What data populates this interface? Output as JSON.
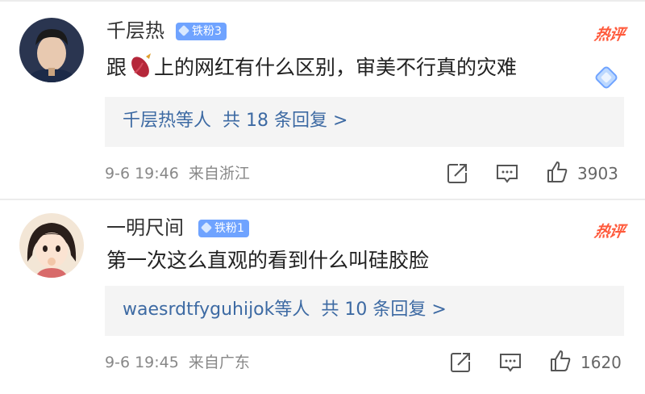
{
  "comments": [
    {
      "username": "千层热",
      "badge": "铁粉3",
      "hot_label": "热评",
      "text_before": "跟",
      "text_after": "上的网红有什么区别，审美不行真的灾难",
      "inline_icon": "sweet-potato-icon",
      "reply": {
        "names": "千层热",
        "deng": "等人",
        "total": "共 18 条回复 >"
      },
      "time": "9-6 19:46",
      "location": "来自浙江",
      "likes": "3903"
    },
    {
      "username": "一明尺间",
      "badge": "铁粉1",
      "hot_label": "热评",
      "text_before": "第一次这么直观的看到什么叫硅胶脸",
      "text_after": "",
      "reply": {
        "names": "waesrdtfyguhijok",
        "deng": "等人",
        "total": "共 10 条回复 >"
      },
      "time": "9-6 19:45",
      "location": "来自广东",
      "likes": "1620"
    }
  ],
  "icons": [
    "share-icon",
    "comment-icon",
    "like-icon",
    "diamond-icon"
  ],
  "colors": {
    "link": "#3d6aa3",
    "hot": "#ff5a3c",
    "badge": "#6fa3ff"
  }
}
